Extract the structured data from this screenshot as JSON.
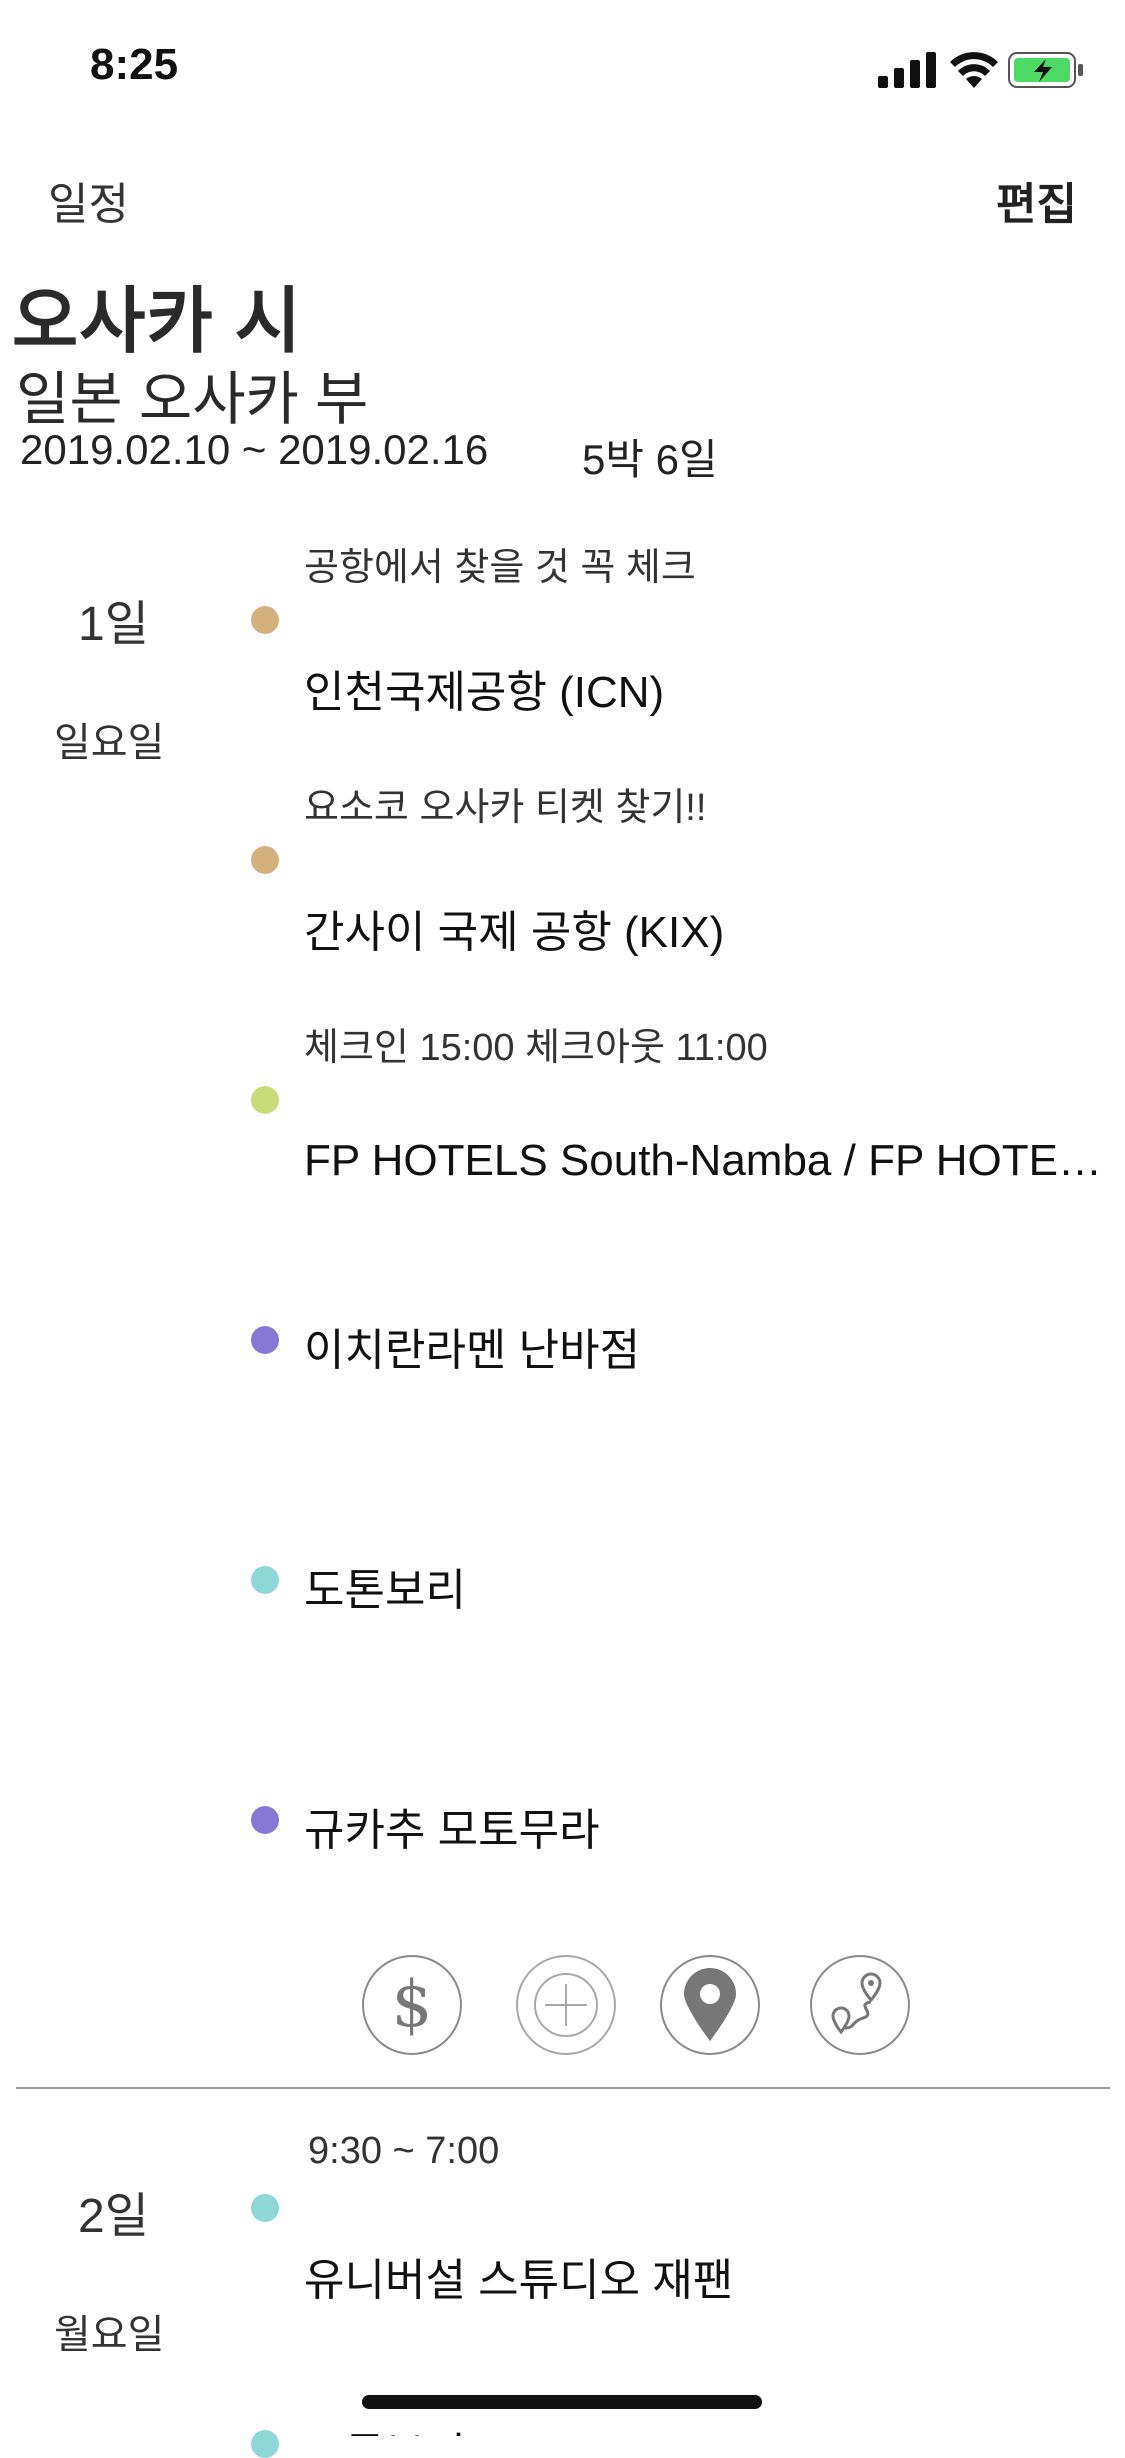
{
  "status_bar": {
    "time": "8:25"
  },
  "nav": {
    "back_label": "일정",
    "edit_label": "편집"
  },
  "trip": {
    "title": "오사카 시",
    "subtitle": "일본 오사카 부",
    "date_range": "2019.02.10 ~ 2019.02.16",
    "duration": "5박 6일"
  },
  "days": [
    {
      "day_label": "1일",
      "weekday": "일요일",
      "items": [
        {
          "note": "공항에서 찾을 것 꼭 체크",
          "place": "인천국제공항 (ICN)",
          "color": "#d4b07c"
        },
        {
          "note": "요소코 오사카 티켓 찾기!!",
          "place": "간사이 국제 공항 (KIX)",
          "color": "#d4b07c"
        },
        {
          "note": "체크인 15:00 체크아웃 11:00",
          "place": "FP HOTELS South-Namba / FP HOTELS South-Namba",
          "color": "#c9dc7c"
        },
        {
          "note": "",
          "place": "이치란라멘 난바점",
          "color": "#8878d6"
        },
        {
          "note": "",
          "place": "도톤보리",
          "color": "#8fd6d6"
        },
        {
          "note": "",
          "place": "규카추 모토무라",
          "color": "#8878d6"
        }
      ]
    },
    {
      "day_label": "2일",
      "weekday": "월요일",
      "items": [
        {
          "note": "9:30 ~ 7:00",
          "place": "유니버설 스튜디오 재팬",
          "color": "#8fd6d6"
        },
        {
          "note": "",
          "place": "도톤보리",
          "color": "#8fd6d6"
        }
      ]
    }
  ],
  "toolbar": {
    "icons": [
      "dollar-icon",
      "plus-icon",
      "map-pin-icon",
      "route-icon"
    ],
    "dollar_glyph": "$"
  }
}
